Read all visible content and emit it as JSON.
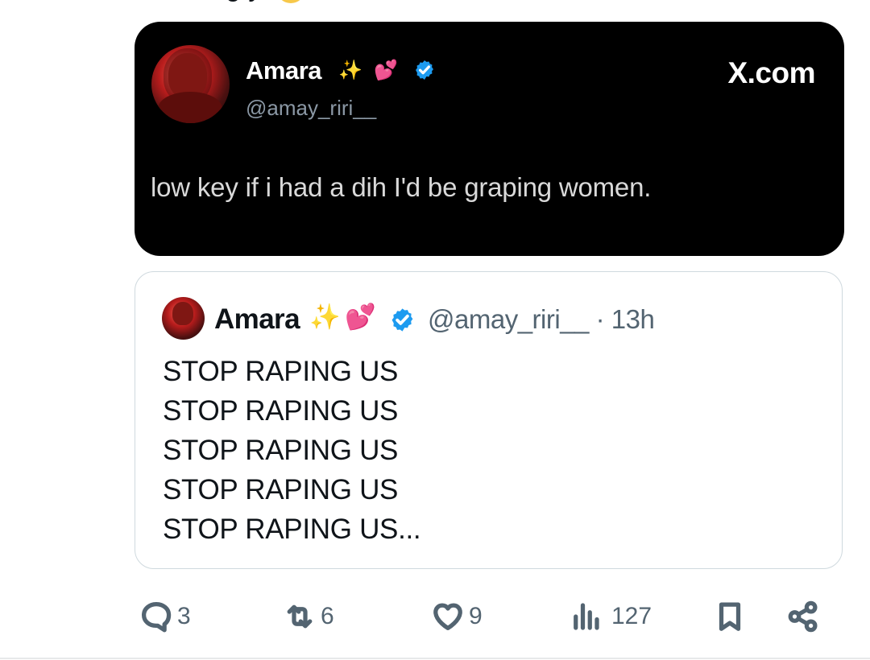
{
  "top_fragment": {
    "text": "g y"
  },
  "embedded_tweet_image": {
    "author_name": "Amara",
    "handle": "@amay_riri__",
    "site": "X.com",
    "body": "low key if i had a dih I'd be graping women."
  },
  "quoted_tweet": {
    "author_name": "Amara",
    "handle": "@amay_riri__",
    "separator": "·",
    "time": "13h",
    "lines": [
      "STOP RAPING US",
      "STOP RAPING US",
      "STOP RAPING US",
      "STOP RAPING US",
      "STOP RAPING US..."
    ]
  },
  "actions": {
    "reply_count": "3",
    "repost_count": "6",
    "like_count": "9",
    "view_count": "127"
  },
  "icons": {
    "reply": "reply-icon",
    "repost": "repost-icon",
    "like": "heart-icon",
    "views": "views-icon",
    "bookmark": "bookmark-icon",
    "share": "share-icon",
    "verified": "verified-badge-icon",
    "sparkles": "sparkles-emoji",
    "hearts": "two-hearts-emoji"
  },
  "colors": {
    "text_primary": "#0f1419",
    "text_secondary": "#536471",
    "verified_blue": "#1d9bf0",
    "media_background": "#000000",
    "border": "#cfd9de"
  }
}
